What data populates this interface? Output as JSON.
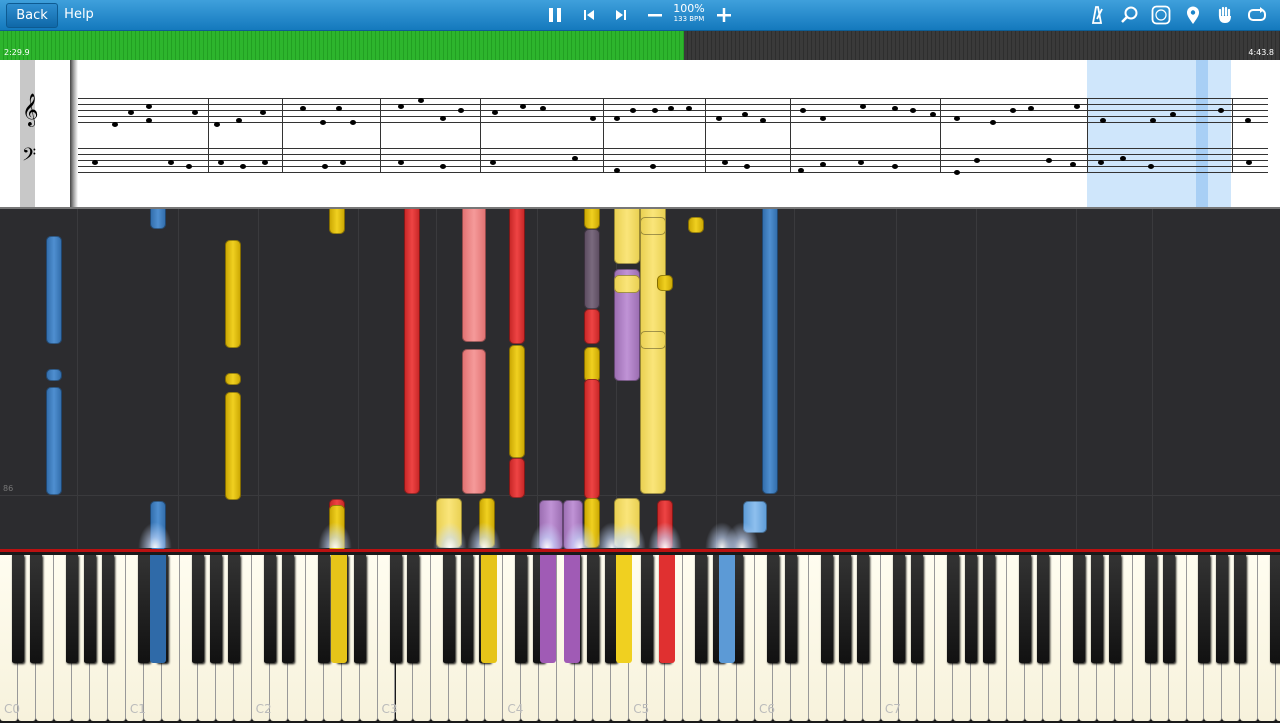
{
  "toolbar": {
    "back_label": "Back",
    "help_label": "Help",
    "zoom_label": "100%",
    "bpm_label": "133 BPM",
    "accent": "#1a84c9"
  },
  "icons": [
    "pause-icon",
    "skip-back-icon",
    "skip-forward-icon",
    "minus-icon",
    "plus-icon",
    "metronome-icon",
    "magnifier-icon",
    "label-icon",
    "location-pin-icon",
    "hand-icon",
    "loop-icon"
  ],
  "progress": {
    "current_time": "2:29.9",
    "total_time": "4:43.8",
    "fraction": 0.534
  },
  "roll": {
    "measure_number": "86"
  },
  "keyboard": {
    "labels": [
      "C0",
      "C1",
      "C2",
      "C3",
      "C4",
      "C5",
      "C6",
      "C7"
    ]
  }
}
